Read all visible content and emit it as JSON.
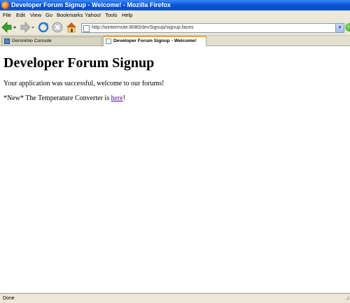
{
  "window": {
    "title": "Developer Forum Signup - Welcome! - Mozilla Firefox"
  },
  "menu": [
    "File",
    "Edit",
    "View",
    "Go",
    "Bookmarks",
    "Yahoo!",
    "Tools",
    "Help"
  ],
  "address_bar": {
    "url": "http://wintermute:8080/devSignup/signup.faces"
  },
  "tabs": [
    {
      "label": "Geronimo Console",
      "active": false
    },
    {
      "label": "Developer Forum Signup - Welcome!",
      "active": true
    }
  ],
  "page": {
    "heading": "Developer Forum Signup",
    "message": "Your application was successful, welcome to our forums!",
    "news_prefix": "*New* The Temperature Converter is ",
    "news_link": "here",
    "news_suffix": "!"
  },
  "status": {
    "text": "Done"
  }
}
